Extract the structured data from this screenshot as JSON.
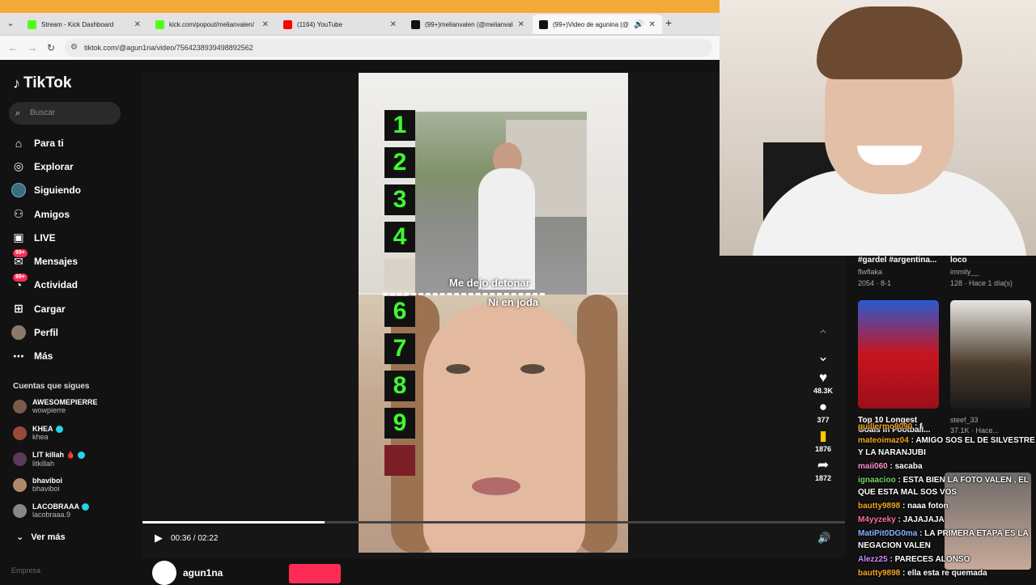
{
  "browser": {
    "tabs": [
      {
        "title": "Stream - Kick Dashboard",
        "favicon_color": "#53fc18"
      },
      {
        "title": "kick.com/popout/melianvalen/",
        "favicon_color": "#53fc18"
      },
      {
        "title": "(1164) YouTube",
        "favicon_color": "#ff0000"
      },
      {
        "title": "(99+)melianvalen (@melianvale",
        "favicon_color": "#111111"
      },
      {
        "title": "(99+)Video de agunina (@a",
        "favicon_color": "#111111"
      }
    ],
    "url": "tiktok.com/@agun1na/video/7564238939498892562"
  },
  "tiktok": {
    "logo": "TikTok",
    "search_placeholder": "Buscar",
    "nav": [
      {
        "label": "Para ti",
        "icon": "home-icon",
        "glyph": "⌂"
      },
      {
        "label": "Explorar",
        "icon": "compass-icon",
        "glyph": "◎"
      },
      {
        "label": "Siguiendo",
        "icon": "following-avatar-icon",
        "glyph": ""
      },
      {
        "label": "Amigos",
        "icon": "friends-icon",
        "glyph": "⚇"
      },
      {
        "label": "LIVE",
        "icon": "live-tv-icon",
        "glyph": "▣"
      },
      {
        "label": "Mensajes",
        "icon": "messages-icon",
        "glyph": "✉",
        "badge": "99+"
      },
      {
        "label": "Actividad",
        "icon": "activity-icon",
        "glyph": "◔",
        "badge": "99+"
      },
      {
        "label": "Cargar",
        "icon": "upload-icon",
        "glyph": "⊞"
      },
      {
        "label": "Perfil",
        "icon": "profile-avatar-icon",
        "glyph": ""
      },
      {
        "label": "Más",
        "icon": "more-icon",
        "glyph": "⋯"
      }
    ],
    "following_title": "Cuentas que sigues",
    "following": [
      {
        "name": "AWESOMEPIERRE",
        "user": "wowpierre",
        "verified": false
      },
      {
        "name": "KHEA",
        "user": "khea",
        "verified": true
      },
      {
        "name": "LIT killah 🩸",
        "user": "litkillah",
        "verified": true
      },
      {
        "name": "bhaviboi",
        "user": "bhaviboi",
        "verified": false
      },
      {
        "name": "LACOBRAAA",
        "user": "lacobraaa.9",
        "verified": true
      }
    ],
    "see_more": "Ver más",
    "company": "Empresa"
  },
  "video": {
    "caption_top": "Me dejo detonar",
    "caption_bottom": "Ni en joda",
    "ranks": [
      "1",
      "2",
      "3",
      "4",
      "",
      "6",
      "7",
      "8",
      "9",
      ""
    ],
    "current_time": "00:36 / 02:22",
    "progress": 0.259,
    "author": "agun1na",
    "likes": "48.3K",
    "comments": "377",
    "saves": "1876",
    "shares": "1872"
  },
  "suggestions": {
    "top_left_title": "#gardel #argentina...",
    "top_left_user": "flwflaka",
    "top_left_stats": "2054 · 8-1",
    "top_right_title": "loco",
    "top_right_user": "immily__",
    "top_right_stats": "128 · Hace 1 día(s)",
    "bottom_left_title": "Top 10 Longest",
    "bottom_left_title2": "Goals in Football...",
    "bottom_right_user": "steef_33",
    "bottom_right_stats": "37.1K · Hace..."
  },
  "chat": [
    {
      "user": "guillermo9090",
      "text": ": f",
      "color": "#f5a623"
    },
    {
      "user": "mateoimaz04",
      "text": ": AMIGO SOS EL DE SILVESTRE Y LA NARANJUBI",
      "color": "#f5a623"
    },
    {
      "user": "maii060",
      "text": ": sacaba",
      "color": "#ff8fd1"
    },
    {
      "user": "ignaacioo",
      "text": ": ESTA BIEN LA FOTO VALEN , EL QUE ESTA MAL SOS VOS",
      "color": "#7bd66b"
    },
    {
      "user": "bautty9898",
      "text": ": naaa foton",
      "color": "#f5a623"
    },
    {
      "user": "M4yyzeky",
      "text": ": JAJAJAJA",
      "color": "#ff6fa1"
    },
    {
      "user": "MatiPit0DG0ma",
      "text": ": LA PRIMERA ETAPA ES LA NEGACION VALEN",
      "color": "#8ab4ff"
    },
    {
      "user": "Alezz25",
      "text": ": PARECES ALONSO",
      "color": "#c98cff"
    },
    {
      "user": "bautty9898",
      "text": ": ella esta re quemada",
      "color": "#f5a623"
    }
  ]
}
